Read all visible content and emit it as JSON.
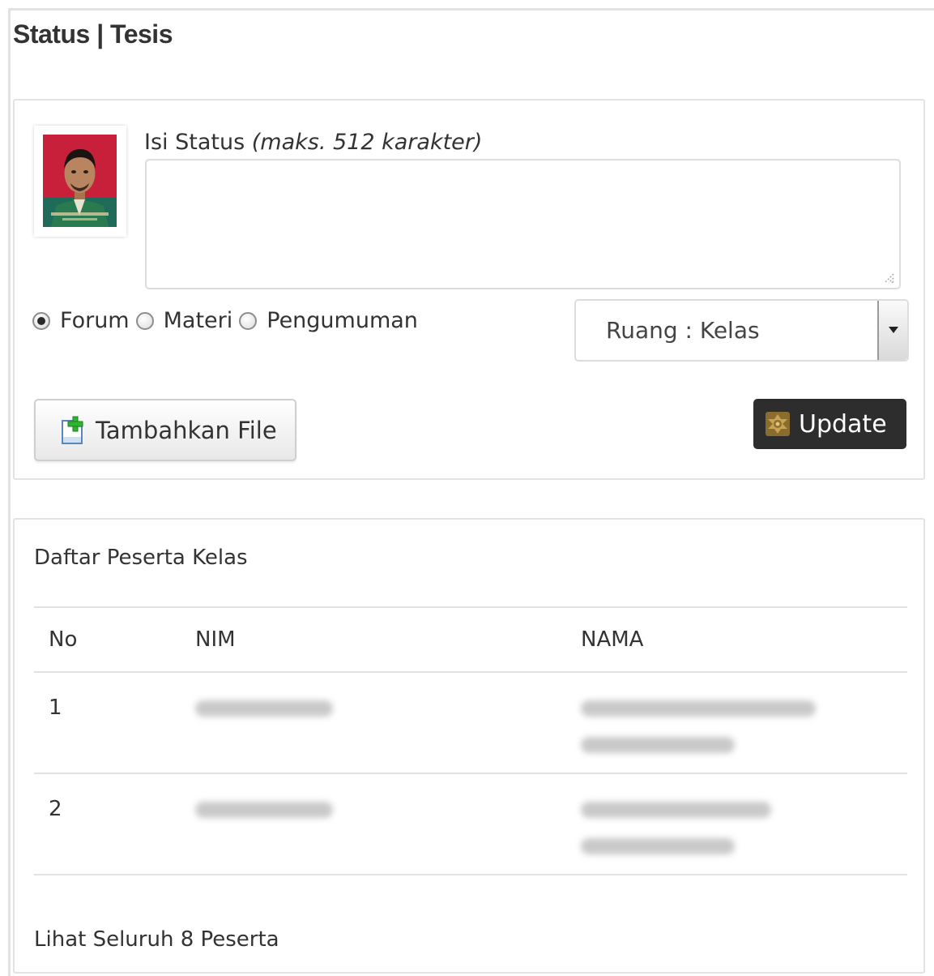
{
  "page": {
    "title": "Status | Tesis"
  },
  "status_form": {
    "label": "Isi Status",
    "label_hint": "(maks. 512 karakter)",
    "textarea_value": "",
    "type_options": [
      {
        "label": "Forum",
        "checked": true
      },
      {
        "label": "Materi",
        "checked": false
      },
      {
        "label": "Pengumuman",
        "checked": false
      }
    ],
    "room_select": {
      "selected": "Ruang : Kelas"
    },
    "add_file_label": "Tambahkan File",
    "update_label": "Update"
  },
  "participants": {
    "title": "Daftar Peserta Kelas",
    "columns": [
      "No",
      "NIM",
      "NAMA"
    ],
    "rows": [
      {
        "no": "1",
        "nim": "[redacted]",
        "nama": "[redacted]"
      },
      {
        "no": "2",
        "nim": "[redacted]",
        "nama": "[redacted]"
      }
    ],
    "footer_link": "Lihat Seluruh 8 Peserta"
  },
  "colors": {
    "update_button": "#2d2d2d",
    "panel_border": "#e3e3e3",
    "file_icon_plus": "#2db52d"
  },
  "icons": {
    "add_file": "add-file-icon",
    "update": "update-icon",
    "select_arrow": "chevron-down-icon"
  }
}
